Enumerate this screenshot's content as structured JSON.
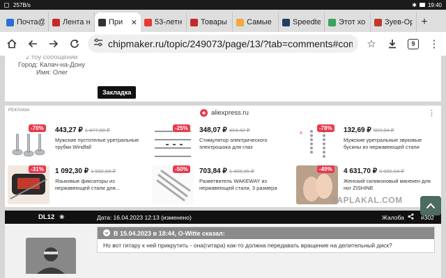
{
  "status_bar": {
    "speed": "257B/s",
    "time": "19:40"
  },
  "tabs": [
    {
      "title": "Почта@",
      "fav_color": "#2b6fd6"
    },
    {
      "title": "Лента н",
      "fav_color": "#c62828"
    },
    {
      "title": "При",
      "fav_color": "#333333"
    },
    {
      "title": "53-летн",
      "fav_color": "#e53935"
    },
    {
      "title": "Товары",
      "fav_color": "#c62828"
    },
    {
      "title": "Самые",
      "fav_color": "#f4a93a"
    },
    {
      "title": "Speedte",
      "fav_color": "#1f3c63"
    },
    {
      "title": "Этот хо",
      "fav_color": "#3aa35f"
    },
    {
      "title": "Зуев-Ор",
      "fav_color": "#c0392b"
    }
  ],
  "toolbar": {
    "url": "chipmaker.ru/topic/249073/page/13/?tab=comments#commen",
    "tab_count": "9"
  },
  "author_info": {
    "posts": "2 тоу сообщении",
    "city": "Город: Калач-на-Дону",
    "name": "Имя: Олег"
  },
  "bookmark_label": "Закладка",
  "ad": {
    "label": "РЕКЛАМА",
    "source": "aliexpress.ru",
    "products": [
      {
        "discount": "-70%",
        "price": "443,27 ₽",
        "old_price": "1 477,88 ₽",
        "desc": "Мужские пустотелые уретральные трубки Windfall"
      },
      {
        "discount": "-25%",
        "price": "348,07 ₽",
        "old_price": "464,42 ₽",
        "desc": "Стимулятор электрического электрошока для глаз"
      },
      {
        "discount": "-78%",
        "price": "132,69 ₽",
        "old_price": "603,84 ₽",
        "desc": "Мужские уретральные звуковые бусины из нержавеющей стали"
      },
      {
        "discount": "-31%",
        "price": "1 092,30 ₽",
        "old_price": "1 582,68 ₽",
        "desc": "Языковые фиксаторы из нержавеющей стали для..."
      },
      {
        "discount": "-50%",
        "price": "703,84 ₽",
        "old_price": "1 408,65 ₽",
        "desc": "Разветвитель WAKEWAY из нержавеющей стали, 3 размера"
      },
      {
        "discount": "-49%",
        "price": "4 631,70 ₽",
        "old_price": "9 082,64 ₽",
        "desc": "Женский силиконовый манекен для ног ZISHINE"
      }
    ]
  },
  "post": {
    "author": "DL12",
    "date": "Дата: 16.04.2023 12:13 (изменено)",
    "report": "Жалоба",
    "number": "#302",
    "quote_head": "В 15.04.2023 в 18:44, O-Witte сказал:",
    "quote_text": "Но вот гитару к ней прикрутить - она(гитара) как-то должна передавать вращение на делительный диск?"
  },
  "watermark": "YAPLAKAL.COM"
}
